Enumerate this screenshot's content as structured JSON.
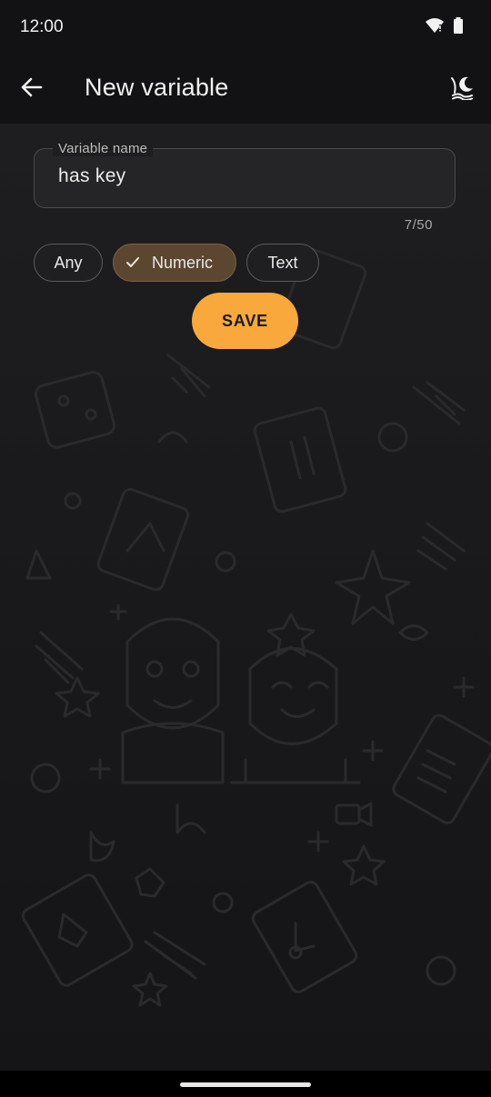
{
  "status_bar": {
    "time": "12:00",
    "icons": [
      "wifi-icon",
      "battery-icon"
    ]
  },
  "app_bar": {
    "title": "New variable",
    "back_icon": "arrow-left-icon",
    "action_icon": "theme-icon"
  },
  "form": {
    "variable_name_label": "Variable name",
    "variable_name_value": "has key",
    "counter": "7/50",
    "type_options": [
      {
        "label": "Any",
        "selected": false
      },
      {
        "label": "Numeric",
        "selected": true
      },
      {
        "label": "Text",
        "selected": false
      }
    ],
    "save_label": "SAVE"
  },
  "colors": {
    "accent": "#f9a93b",
    "selected_chip": "#5b4630",
    "background": "#121214"
  }
}
